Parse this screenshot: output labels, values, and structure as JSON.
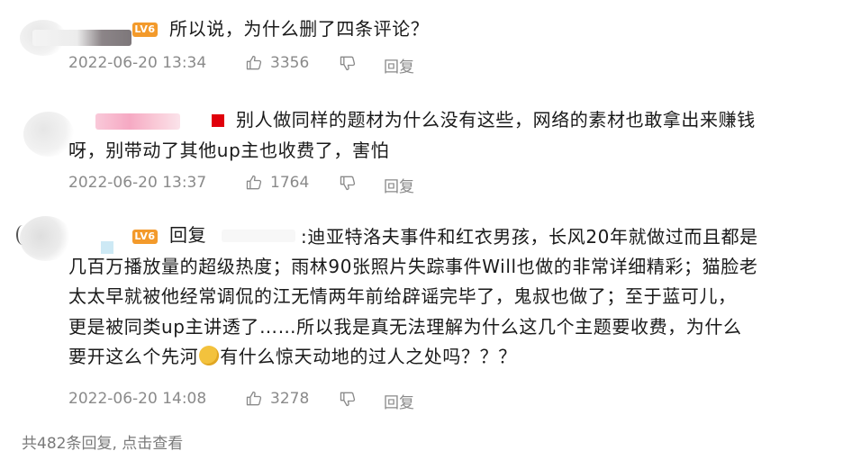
{
  "replies": [
    {
      "level_badge": "LV6",
      "lines": [
        "所以说，为什么删了四条评论？"
      ],
      "date": "2022-06-20 13:34",
      "likes": "3356",
      "reply_label": "回复"
    },
    {
      "lines": [
        "别人做同样的题材为什么没有这些，网络的素材也敢拿出来赚钱",
        "呀，别带动了其他up主也收费了，害怕"
      ],
      "date": "2022-06-20 13:37",
      "likes": "1764",
      "reply_label": "回复"
    },
    {
      "level_badge": "LV6",
      "reply_prefix": "回复",
      "lines": [
        ":迪亚特洛夫事件和红衣男孩，长风20年就做过而且都是",
        "几百万播放量的超级热度；雨林90张照片失踪事件Will也做的非常详细精彩；猫脸老",
        "太太早就被他经常调侃的江无情两年前给辟谣完毕了，鬼叔也做了；至于蓝可儿，",
        "更是被同类up主讲透了……所以我是真无法理解为什么这几个主题要收费，为什么",
        "要开这么个先河",
        "有什么惊天动地的过人之处吗？？？"
      ],
      "date": "2022-06-20 14:08",
      "likes": "3278",
      "reply_label": "回复"
    }
  ],
  "footer": {
    "text": "共482条回复, 点击查看"
  },
  "colors": {
    "badge": "#f39a2b",
    "meta": "#8a8a8a",
    "red_tag": "#e0000b"
  }
}
